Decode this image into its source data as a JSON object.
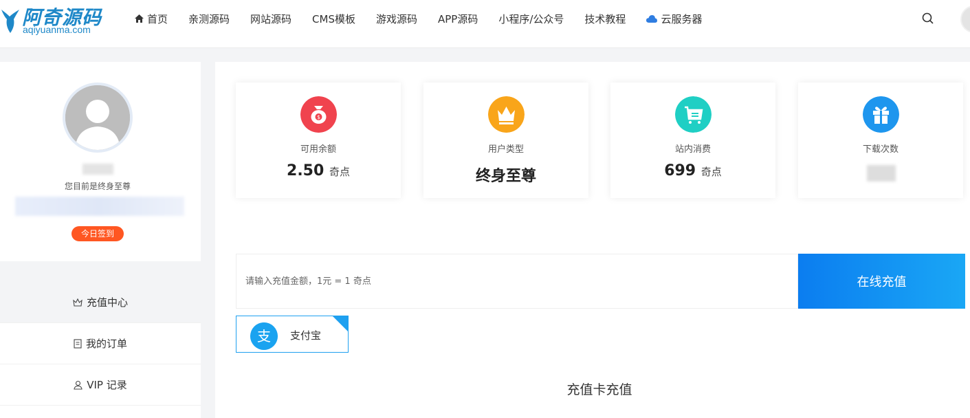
{
  "header": {
    "logo_title": "阿奇源码",
    "logo_sub": "aqiyuanma.com",
    "nav": [
      {
        "label": "首页",
        "icon": "home-icon"
      },
      {
        "label": "亲测源码"
      },
      {
        "label": "网站源码"
      },
      {
        "label": "CMS模板"
      },
      {
        "label": "游戏源码"
      },
      {
        "label": "APP源码"
      },
      {
        "label": "小程序/公众号"
      },
      {
        "label": "技术教程"
      },
      {
        "label": "云服务器",
        "icon": "cloud-icon"
      }
    ]
  },
  "profile": {
    "member_text": "您目前是终身至尊",
    "checkin_label": "今日签到"
  },
  "menu": [
    {
      "label": "充值中心",
      "icon": "crown-icon",
      "active": true
    },
    {
      "label": "我的订单",
      "icon": "order-icon"
    },
    {
      "label": "VIP 记录",
      "icon": "user-icon"
    }
  ],
  "stats": [
    {
      "label": "可用余额",
      "value": "2.50",
      "unit": "奇点",
      "icon": "money-bag-icon",
      "color": "#f0434e"
    },
    {
      "label": "用户类型",
      "value": "终身至尊",
      "icon": "crown-icon",
      "color": "#f9a51a"
    },
    {
      "label": "站内消费",
      "value": "699",
      "unit": "奇点",
      "icon": "cart-icon",
      "color": "#1fcfc4"
    },
    {
      "label": "下载次数",
      "icon": "gift-icon",
      "color": "#1e96ee"
    }
  ],
  "recharge": {
    "placeholder": "请输入充值金额，1元 = 1 奇点",
    "button_label": "在线充值"
  },
  "payment": {
    "label": "支付宝"
  },
  "card_recharge_title": "充值卡充值"
}
